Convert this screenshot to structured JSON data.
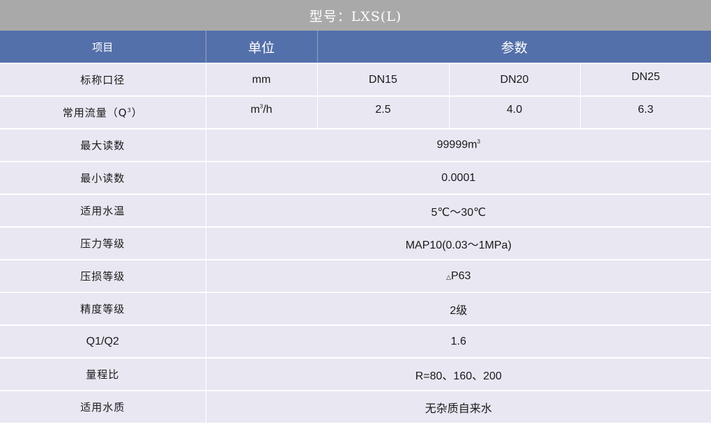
{
  "title": "型号：LXS(L)",
  "header": {
    "item": "项目",
    "unit": "单位",
    "params": "参数"
  },
  "rows": [
    {
      "label": "标称口径",
      "unit": "mm",
      "values": [
        "DN15",
        "DN20",
        "DN25"
      ]
    },
    {
      "label_main": "常用流量（Q",
      "label_sup": "3",
      "label_end": "）",
      "unit_main": "m",
      "unit_sup": "3",
      "unit_end": "/h",
      "values": [
        "2.5",
        "4.0",
        "6.3"
      ]
    },
    {
      "label": "最大读数",
      "value_main": "99999m",
      "value_sup": "3"
    },
    {
      "label": "最小读数",
      "value": "0.0001"
    },
    {
      "label": "适用水温",
      "value": "5℃～30℃"
    },
    {
      "label": "压力等级",
      "value": "MAP10(0.03～1MPa)"
    },
    {
      "label": "压损等级",
      "value_prefix": "△",
      "value": "P63"
    },
    {
      "label": "精度等级",
      "value": "2级"
    },
    {
      "label": "Q1/Q2",
      "value": "1.6"
    },
    {
      "label": "量程比",
      "value": "R=80、160、200"
    },
    {
      "label": "适用水质",
      "value": "无杂质自来水"
    }
  ]
}
